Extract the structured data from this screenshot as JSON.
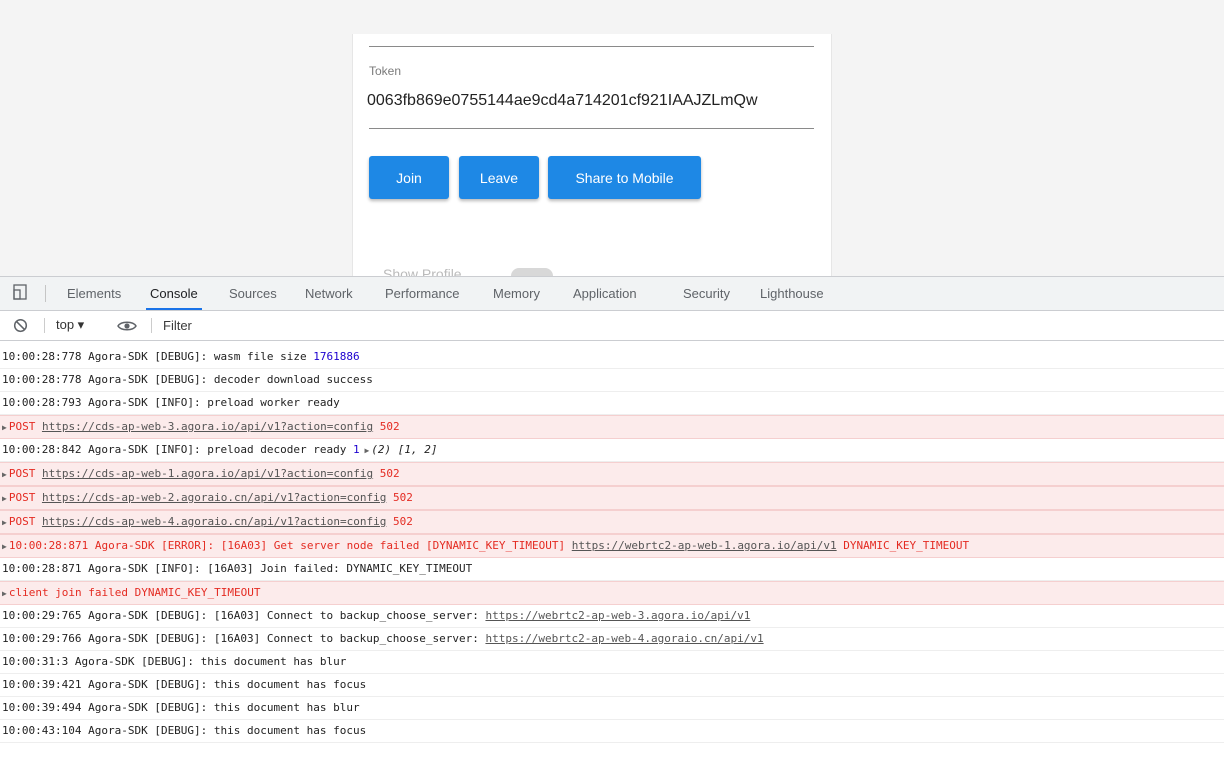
{
  "page": {
    "token_label": "Token",
    "token_value": "0063fb869e0755144ae9cd4a714201cf921IAAJZLmQw",
    "buttons": {
      "join": "Join",
      "leave": "Leave",
      "share": "Share to Mobile"
    },
    "peek_text": "Show Profile",
    "accent_color": "#1e88e5"
  },
  "devtools": {
    "tabs": [
      "Elements",
      "Console",
      "Sources",
      "Network",
      "Performance",
      "Memory",
      "Application",
      "Security",
      "Lighthouse"
    ],
    "active_tab": "Console",
    "toolbar": {
      "context": "top ▾",
      "filter_placeholder": "Filter"
    },
    "console": [
      {
        "type": "log",
        "text": "10:00:28:778 Agora-SDK [DEBUG]: wasm file size ",
        "num": "1761886"
      },
      {
        "type": "log",
        "text": "10:00:28:778 Agora-SDK [DEBUG]: decoder download success"
      },
      {
        "type": "log",
        "text": "10:00:28:793 Agora-SDK [INFO]: preload worker ready"
      },
      {
        "type": "error",
        "prefix": "POST ",
        "url": "https://cds-ap-web-3.agora.io/api/v1?action=config",
        "suffix": " 502"
      },
      {
        "type": "log",
        "text": "10:00:28:842 Agora-SDK [INFO]: preload decoder ready ",
        "num": "1",
        "obj": "(2) [1, 2]"
      },
      {
        "type": "error",
        "prefix": "POST ",
        "url": "https://cds-ap-web-1.agora.io/api/v1?action=config",
        "suffix": " 502"
      },
      {
        "type": "error",
        "prefix": "POST ",
        "url": "https://cds-ap-web-2.agoraio.cn/api/v1?action=config",
        "suffix": " 502"
      },
      {
        "type": "error",
        "prefix": "POST ",
        "url": "https://cds-ap-web-4.agoraio.cn/api/v1?action=config",
        "suffix": " 502"
      },
      {
        "type": "error",
        "prefix": "10:00:28:871 Agora-SDK [ERROR]: [16A03] Get server node failed [DYNAMIC_KEY_TIMEOUT] ",
        "url": "https://webrtc2-ap-web-1.agora.io/api/v1",
        "suffix": " DYNAMIC_KEY_TIMEOUT"
      },
      {
        "type": "log",
        "text": "10:00:28:871 Agora-SDK [INFO]: [16A03] Join failed: DYNAMIC_KEY_TIMEOUT"
      },
      {
        "type": "error",
        "prefix": "client join failed DYNAMIC_KEY_TIMEOUT"
      },
      {
        "type": "log",
        "text": "10:00:29:765 Agora-SDK [DEBUG]: [16A03] Connect to backup_choose_server: ",
        "url": "https://webrtc2-ap-web-3.agora.io/api/v1"
      },
      {
        "type": "log",
        "text": "10:00:29:766 Agora-SDK [DEBUG]: [16A03] Connect to backup_choose_server: ",
        "url": "https://webrtc2-ap-web-4.agoraio.cn/api/v1"
      },
      {
        "type": "log",
        "text": "10:00:31:3 Agora-SDK [DEBUG]: this document has blur"
      },
      {
        "type": "log",
        "text": "10:00:39:421 Agora-SDK [DEBUG]: this document has focus"
      },
      {
        "type": "log",
        "text": "10:00:39:494 Agora-SDK [DEBUG]: this document has blur"
      },
      {
        "type": "log",
        "text": "10:00:43:104 Agora-SDK [DEBUG]: this document has focus"
      }
    ]
  }
}
